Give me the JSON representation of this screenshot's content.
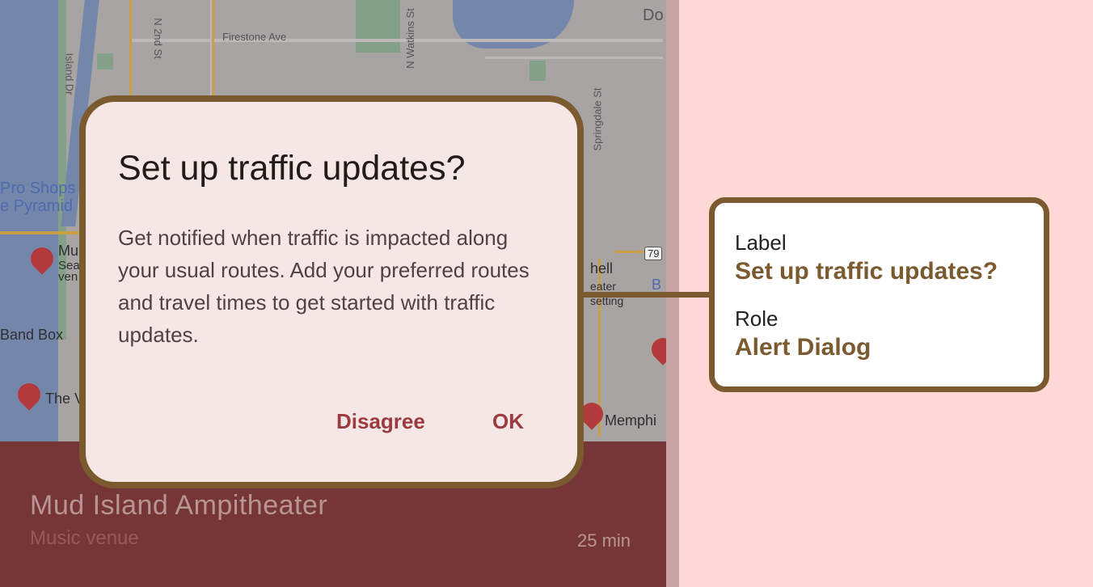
{
  "map": {
    "streets": [
      "Firestone Ave",
      "N 2nd St",
      "N Watkins St",
      "Island Dr",
      "Springdale St"
    ],
    "corner_text": "Do",
    "pois": [
      "Pro Shops",
      "e Pyramid",
      "Mu",
      "Sea",
      "ven",
      "Band Box",
      "The V",
      "hell",
      "eater",
      "setting",
      "Memphi",
      "B"
    ],
    "highway_shield": "79"
  },
  "dialog": {
    "title": "Set up traffic updates?",
    "body": "Get notified when traffic is impacted along your usual routes. Add your preferred routes and travel times to get started with traffic updates.",
    "dismiss_label": "Disagree",
    "confirm_label": "OK"
  },
  "sheet": {
    "place_name": "Mud Island Ampitheater",
    "place_type": "Music venue",
    "eta": "25 min"
  },
  "callout": {
    "label_key": "Label",
    "label_value": "Set up traffic updates?",
    "role_key": "Role",
    "role_value": "Alert Dialog"
  },
  "colors": {
    "accent": "#7a5a2e",
    "button": "#9b3b3f",
    "sheet": "#763638",
    "background": "#ffd9d6"
  }
}
